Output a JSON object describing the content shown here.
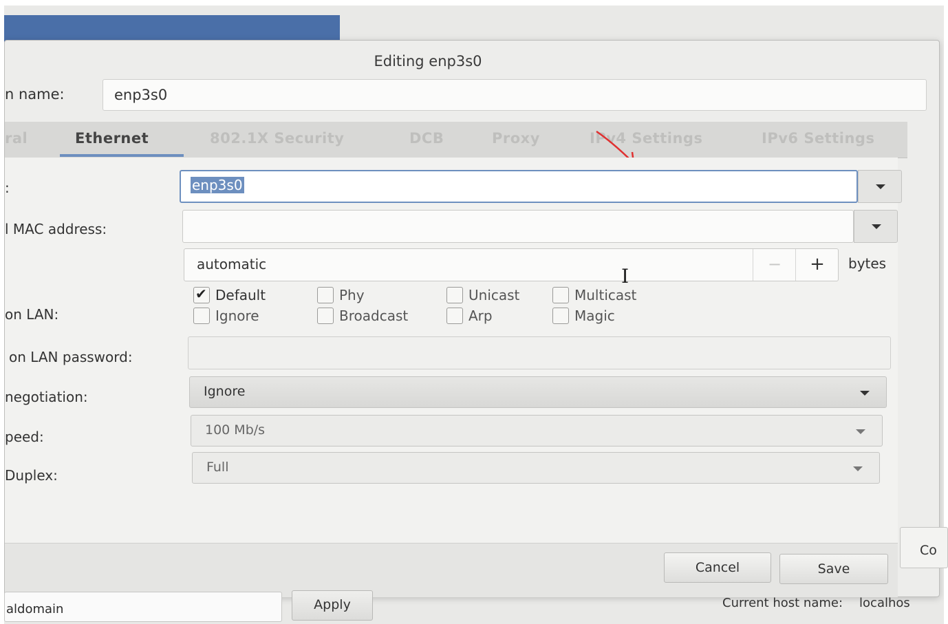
{
  "dialog": {
    "title": "Editing enp3s0",
    "connection_name_label": "n name:",
    "connection_name_value": "enp3s0"
  },
  "tabs": [
    {
      "label": "ral",
      "active": false
    },
    {
      "label": "Ethernet",
      "active": true
    },
    {
      "label": "802.1X Security",
      "active": false
    },
    {
      "label": "DCB",
      "active": false
    },
    {
      "label": "Proxy",
      "active": false
    },
    {
      "label": "IPv4 Settings",
      "active": false
    },
    {
      "label": "IPv6 Settings",
      "active": false
    }
  ],
  "ethernet": {
    "device_label": ":",
    "device_value": "enp3s0",
    "cloned_mac_label": "l MAC address:",
    "cloned_mac_value": "",
    "mtu_value": "automatic",
    "mtu_unit": "bytes",
    "mtu_minus": "−",
    "mtu_plus": "+",
    "wol_label": "on LAN:",
    "wol_options": [
      {
        "label": "Default",
        "checked": true
      },
      {
        "label": "Phy",
        "checked": false
      },
      {
        "label": "Unicast",
        "checked": false
      },
      {
        "label": "Multicast",
        "checked": false
      },
      {
        "label": "Ignore",
        "checked": false
      },
      {
        "label": "Broadcast",
        "checked": false
      },
      {
        "label": "Arp",
        "checked": false
      },
      {
        "label": "Magic",
        "checked": false
      }
    ],
    "wol_password_label": "on LAN password:",
    "wol_password_value": "",
    "negotiation_label": "negotiation:",
    "negotiation_value": "Ignore",
    "speed_label": "peed:",
    "speed_value": "100 Mb/s",
    "duplex_label": "Duplex:",
    "duplex_value": "Full"
  },
  "buttons": {
    "cancel": "Cancel",
    "save": "Save"
  },
  "background": {
    "hostname_value": "aldomain",
    "apply_label": "Apply",
    "current_host_label": "Current host name:",
    "current_host_value": "localhos",
    "co_button_label": "Co"
  },
  "colors": {
    "accent": "#6d8fbf",
    "annotation_arrow": "#e03030"
  }
}
